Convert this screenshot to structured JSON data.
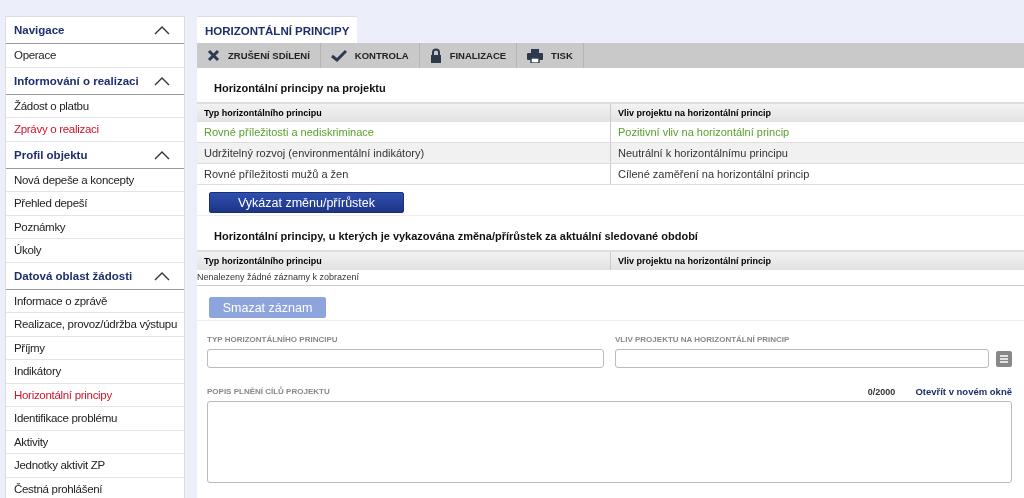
{
  "sidebar": {
    "sections": [
      {
        "title": "Navigace",
        "expanded": true,
        "items": [
          {
            "label": "Operace",
            "selected": false
          }
        ]
      },
      {
        "title": "Informování o realizaci",
        "expanded": true,
        "items": [
          {
            "label": "Žádost o platbu",
            "selected": false
          },
          {
            "label": "Zprávy o realizaci",
            "selected": true
          }
        ]
      },
      {
        "title": "Profil objektu",
        "expanded": true,
        "items": [
          {
            "label": "Nová depeše a koncepty",
            "selected": false
          },
          {
            "label": "Přehled depeší",
            "selected": false
          },
          {
            "label": "Poznámky",
            "selected": false
          },
          {
            "label": "Úkoly",
            "selected": false
          }
        ]
      },
      {
        "title": "Datová oblast žádosti",
        "expanded": true,
        "items": [
          {
            "label": "Informace o zprávě",
            "selected": false
          },
          {
            "label": "Realizace, provoz/údržba výstupu",
            "selected": false
          },
          {
            "label": "Příjmy",
            "selected": false
          },
          {
            "label": "Indikátory",
            "selected": false
          },
          {
            "label": "Horizontální principy",
            "selected": true
          },
          {
            "label": "Identifikace problému",
            "selected": false
          },
          {
            "label": "Aktivity",
            "selected": false
          },
          {
            "label": "Jednotky aktivit ZP",
            "selected": false
          },
          {
            "label": "Čestná prohlášení",
            "selected": false
          }
        ]
      }
    ]
  },
  "tab": {
    "label": "HORIZONTÁLNÍ PRINCIPY",
    "selected": true
  },
  "toolbar": [
    {
      "kind": "cancel",
      "label": "ZRUŠENÍ SDÍLENÍ"
    },
    {
      "kind": "check",
      "label": "KONTROLA"
    },
    {
      "kind": "lock",
      "label": "FINALIZACE"
    },
    {
      "kind": "print",
      "label": "TISK"
    }
  ],
  "project_table": {
    "title": "Horizontální principy na projektu",
    "columns": [
      "Typ horizontálního principu",
      "Vliv projektu na horizontální princip"
    ],
    "rows": [
      {
        "cells": [
          "Rovné příležitosti a nediskriminace",
          "Pozitivní vliv na horizontální princip"
        ],
        "selected": true
      },
      {
        "cells": [
          "Udržitelný rozvoj (environmentální indikátory)",
          "Neutrální k horizontálnímu principu"
        ],
        "selected": false
      },
      {
        "cells": [
          "Rovné příležitosti mužů a žen",
          "Cílené zaměření na horizontální princip"
        ],
        "selected": false
      }
    ]
  },
  "report_button": {
    "label": "Vykázat změnu/přírůstek",
    "disabled": false
  },
  "change_table": {
    "title": "Horizontální principy, u kterých je vykazována změna/přírůstek za aktuální sledované období",
    "columns": [
      "Typ horizontálního principu",
      "Vliv projektu na horizontální princip"
    ],
    "empty_text": "Nenalezeny žádné záznamy k zobrazení"
  },
  "delete_button": {
    "label": "Smazat záznam",
    "disabled": true
  },
  "form": {
    "type_label": "TYP HORIZONTÁLNÍHO PRINCIPU",
    "impact_label": "VLIV PROJEKTU NA HORIZONTÁLNÍ PRINCIP",
    "description_label": "POPIS PLNĚNÍ CÍLŮ PROJEKTU",
    "counter": "0/2000",
    "open_link": "Otevřít v novém okně"
  }
}
